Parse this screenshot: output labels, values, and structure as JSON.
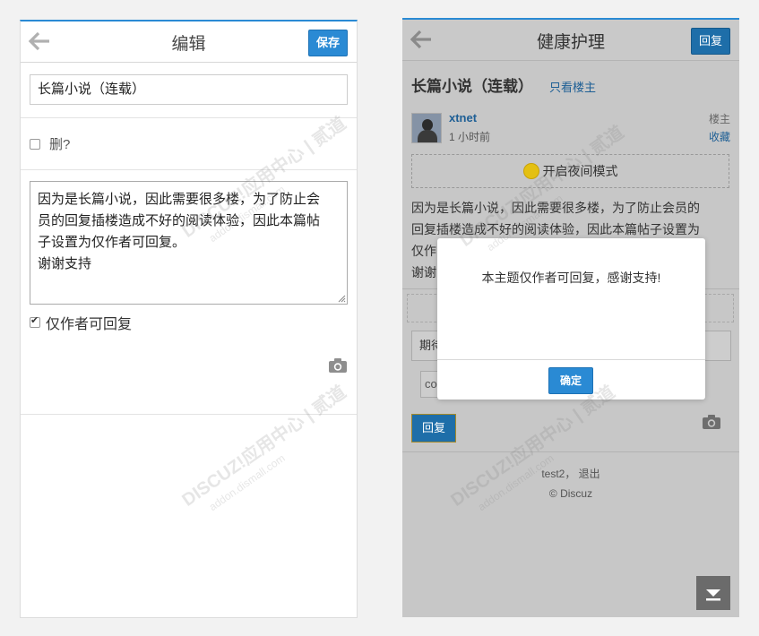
{
  "left_screen": {
    "header": {
      "back_icon": "arrow-left-icon",
      "title": "编辑",
      "save_label": "保存"
    },
    "subject": {
      "value": "长篇小说（连载）"
    },
    "delete_option": {
      "label": "删?",
      "checked": false
    },
    "message": {
      "lines": [
        "因为是长篇小说，因此需要很多楼，为了防止会",
        "员的回复插楼造成不好的阅读体验，因此本篇帖",
        "子设置为仅作者可回复。",
        "谢谢支持"
      ]
    },
    "author_only_option": {
      "label": "仅作者可回复",
      "checked": true
    },
    "camera_icon": "camera-icon"
  },
  "right_screen": {
    "header": {
      "back_icon": "arrow-left-icon",
      "title": "健康护理",
      "reply_label": "回复"
    },
    "thread": {
      "title": "长篇小说（连载）",
      "only_author_link": "只看楼主"
    },
    "post": {
      "username": "xtnet",
      "time": "1 小时前",
      "floor": "楼主",
      "favorite": "收藏",
      "night_mode_label": "开启夜间模式",
      "body_lines": [
        "因为是长篇小说，因此需要很多楼，为了防止会员的",
        "回复插楼造成不好的阅读体验，因此本篇帖子设置为",
        "仅作",
        "谢谢"
      ]
    },
    "reply_form": {
      "input_partial": "期待",
      "code_partial": "co",
      "reply_button": "回复",
      "camera_icon": "camera-icon"
    },
    "footer": {
      "user_line": "test2， 退出",
      "copyright": "© Discuz"
    },
    "scroll_button_icon": "chevron-down-icon",
    "modal": {
      "message": "本主题仅作者可回复，感谢支持!",
      "confirm_label": "确定"
    }
  },
  "watermark": {
    "text": "DISCUZ!应用中心 | 贰道",
    "subtext": "addon.dismall.com"
  },
  "colors": {
    "accent_blue": "#2a8ad4",
    "link_blue": "#1e5f95",
    "overlay_gray": "#c7c7c7",
    "night_yellow": "#e4c012"
  }
}
